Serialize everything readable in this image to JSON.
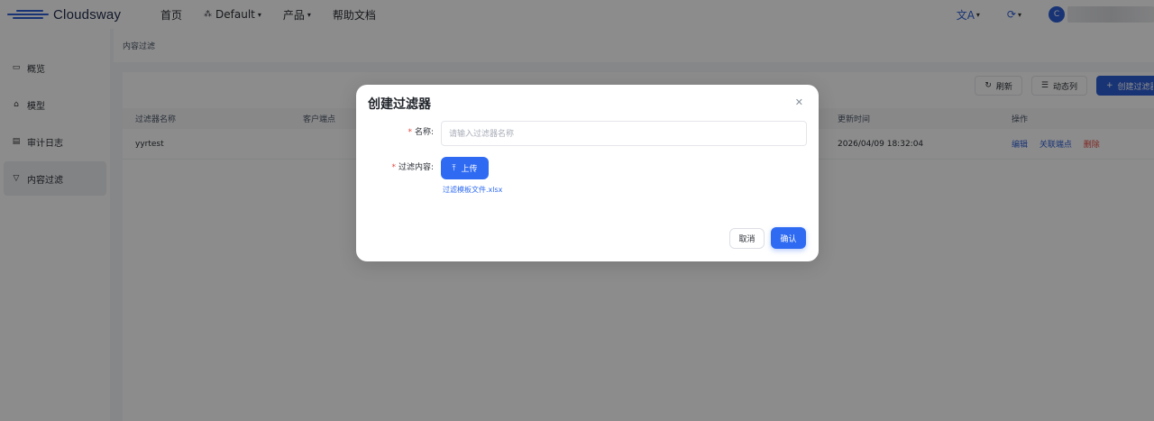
{
  "header": {
    "brand": "Cloudsway",
    "nav": [
      {
        "label": "首页"
      },
      {
        "label": "Default"
      },
      {
        "label": "产品"
      },
      {
        "label": "帮助文档"
      }
    ],
    "translate_icon": "translate-icon",
    "language_icon": "language-icon",
    "avatar_initial": "C"
  },
  "sidebar": {
    "items": [
      {
        "label": "概览",
        "icon": "monitor-icon"
      },
      {
        "label": "模型",
        "icon": "model-icon"
      },
      {
        "label": "审计日志",
        "icon": "log-icon"
      },
      {
        "label": "内容过滤",
        "icon": "filter-icon",
        "active": true
      }
    ]
  },
  "breadcrumb": "内容过滤",
  "toolbar": {
    "refresh": "刷新",
    "columns": "动态列",
    "create": "创建过滤器"
  },
  "table": {
    "headers": [
      "过滤器名称",
      "客户端点",
      "更新时间",
      "操作"
    ],
    "rows": [
      {
        "name": "yyrtest",
        "updated": "2026/04/09 18:32:04",
        "actions": [
          "编辑",
          "关联端点",
          "删除"
        ]
      }
    ]
  },
  "modal": {
    "title": "创建过滤器",
    "name_label": "名称:",
    "name_placeholder": "请输入过滤器名称",
    "content_label": "过滤内容:",
    "upload_label": "上传",
    "template_link": "过滤模板文件.xlsx",
    "cancel": "取消",
    "confirm": "确认"
  },
  "colors": {
    "primary": "#2f6bf2",
    "danger": "#e5483f"
  }
}
